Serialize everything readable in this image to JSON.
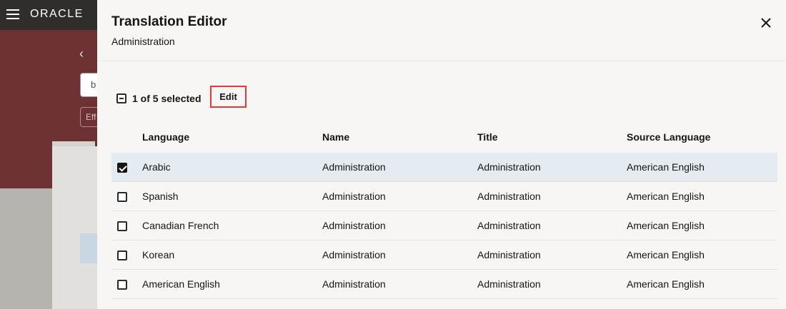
{
  "app": {
    "logo_text": "ORACLE",
    "back_field_text": "b",
    "filter_chip_text": "Eff"
  },
  "drawer": {
    "title": "Translation Editor",
    "subtitle": "Administration",
    "selection_text": "1 of 5 selected",
    "edit_label": "Edit",
    "close_icon": "close-icon",
    "columns": {
      "language": "Language",
      "name": "Name",
      "title": "Title",
      "source_language": "Source Language"
    },
    "rows": [
      {
        "language": "Arabic",
        "name": "Administration",
        "title": "Administration",
        "source_language": "American English",
        "checked": true
      },
      {
        "language": "Spanish",
        "name": "Administration",
        "title": "Administration",
        "source_language": "American English",
        "checked": false
      },
      {
        "language": "Canadian French",
        "name": "Administration",
        "title": "Administration",
        "source_language": "American English",
        "checked": false
      },
      {
        "language": "Korean",
        "name": "Administration",
        "title": "Administration",
        "source_language": "American English",
        "checked": false
      },
      {
        "language": "American English",
        "name": "Administration",
        "title": "Administration",
        "source_language": "American English",
        "checked": false
      }
    ]
  },
  "colors": {
    "header_bg": "#312d2a",
    "banner_bg": "#6e3133",
    "drawer_bg": "#f8f6f4",
    "selected_row_bg": "#e4ecf1",
    "highlight_border": "#e0393e"
  }
}
